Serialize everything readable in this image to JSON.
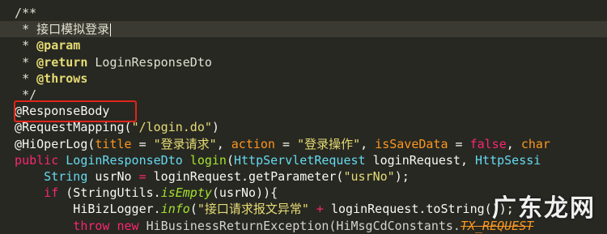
{
  "editor": {
    "lines": [
      [
        {
          "t": "  /**",
          "c": "comment"
        }
      ],
      [
        {
          "t": "   * 接口模拟登录",
          "c": "comment"
        }
      ],
      [
        {
          "t": "   * ",
          "c": "comment"
        },
        {
          "t": "@param",
          "c": "doctag"
        }
      ],
      [
        {
          "t": "   * ",
          "c": "comment"
        },
        {
          "t": "@return",
          "c": "doctag"
        },
        {
          "t": " LoginResponseDto",
          "c": "comment"
        }
      ],
      [
        {
          "t": "   * ",
          "c": "comment"
        },
        {
          "t": "@throws",
          "c": "doctag"
        }
      ],
      [
        {
          "t": "   */",
          "c": "comment"
        }
      ],
      [
        {
          "t": "  @ResponseBody",
          "c": "annot"
        }
      ],
      [
        {
          "t": "  @RequestMapping(",
          "c": "annot"
        },
        {
          "t": "\"/login.do\"",
          "c": "str"
        },
        {
          "t": ")",
          "c": "plain"
        }
      ],
      [
        {
          "t": "  @HiOperLog(",
          "c": "annot"
        },
        {
          "t": "title",
          "c": "param"
        },
        {
          "t": " = ",
          "c": "plain"
        },
        {
          "t": "\"登录请求\"",
          "c": "str"
        },
        {
          "t": ", ",
          "c": "plain"
        },
        {
          "t": "action",
          "c": "param"
        },
        {
          "t": " = ",
          "c": "plain"
        },
        {
          "t": "\"登录操作\"",
          "c": "str"
        },
        {
          "t": ", ",
          "c": "plain"
        },
        {
          "t": "isSaveData",
          "c": "param"
        },
        {
          "t": " = ",
          "c": "plain"
        },
        {
          "t": "false",
          "c": "kw"
        },
        {
          "t": ", ",
          "c": "plain"
        },
        {
          "t": "char",
          "c": "param"
        }
      ],
      [
        {
          "t": "  public ",
          "c": "kw"
        },
        {
          "t": "LoginResponseDto",
          "c": "type"
        },
        {
          "t": " login",
          "c": "fn"
        },
        {
          "t": "(",
          "c": "plain"
        },
        {
          "t": "HttpServletRequest",
          "c": "type"
        },
        {
          "t": " loginRequest, ",
          "c": "plain"
        },
        {
          "t": "HttpSessi",
          "c": "type"
        }
      ],
      [
        {
          "t": "      String",
          "c": "type"
        },
        {
          "t": " usrNo ",
          "c": "plain"
        },
        {
          "t": "=",
          "c": "kw"
        },
        {
          "t": " loginRequest.getParameter(",
          "c": "plain"
        },
        {
          "t": "\"usrNo\"",
          "c": "str"
        },
        {
          "t": ");",
          "c": "plain"
        }
      ],
      [
        {
          "t": "      if",
          "c": "kw"
        },
        {
          "t": " (StringUtils.",
          "c": "plain"
        },
        {
          "t": "isEmpty",
          "c": "fn italic"
        },
        {
          "t": "(usrNo)){",
          "c": "plain"
        }
      ],
      [
        {
          "t": "          HiBizLogger.",
          "c": "plain"
        },
        {
          "t": "info",
          "c": "fn italic"
        },
        {
          "t": "(",
          "c": "plain"
        },
        {
          "t": "\"接口请求报文异常\"",
          "c": "str"
        },
        {
          "t": " + ",
          "c": "kw"
        },
        {
          "t": "loginRequest.toString());",
          "c": "plain"
        }
      ],
      [
        {
          "t": "          throw new ",
          "c": "kw"
        },
        {
          "t": "HiBusinessReturnException(HiMsgCdConstants.",
          "c": "dim"
        },
        {
          "t": "TX_REQUEST",
          "c": "param italic strike"
        }
      ]
    ],
    "current_line": 1
  },
  "watermark": {
    "text": "广东龙网"
  }
}
